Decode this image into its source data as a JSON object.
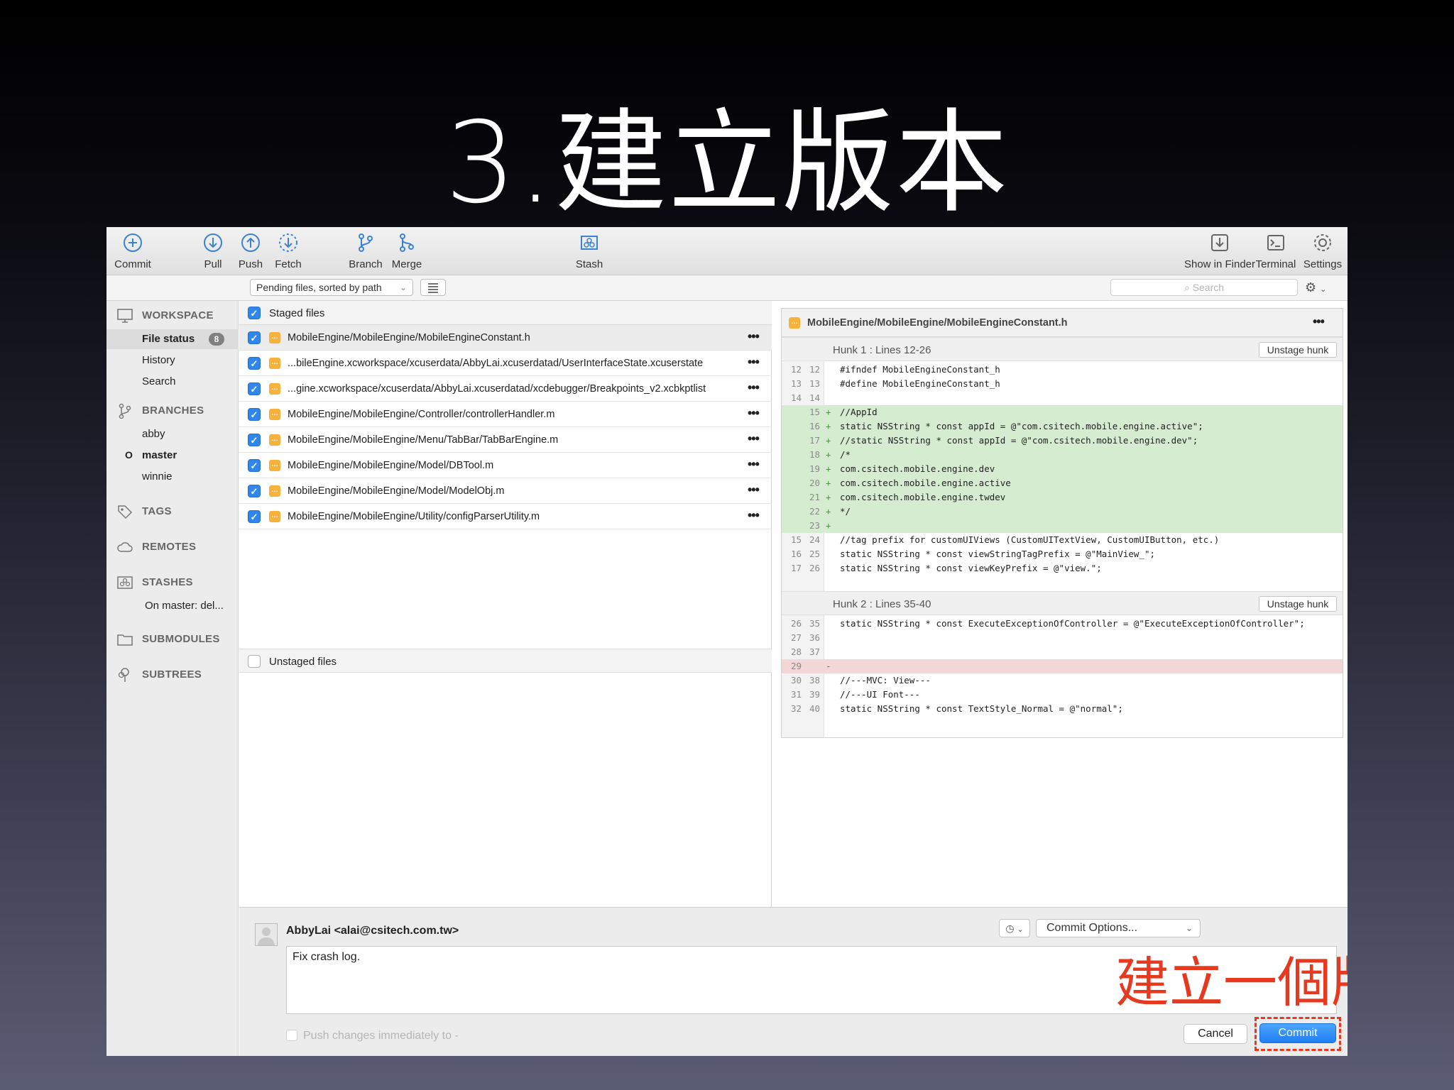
{
  "slide": {
    "title": "3.建立版本"
  },
  "toolbar": {
    "commit": "Commit",
    "pull": "Pull",
    "push": "Push",
    "fetch": "Fetch",
    "branch": "Branch",
    "merge": "Merge",
    "stash": "Stash",
    "show_in_finder": "Show in Finder",
    "terminal": "Terminal",
    "settings": "Settings"
  },
  "filter": {
    "sort_label": "Pending files, sorted by path",
    "search_placeholder": "Search"
  },
  "sidebar": {
    "workspace": "WORKSPACE",
    "file_status": "File status",
    "file_status_count": "8",
    "history": "History",
    "search": "Search",
    "branches": "BRANCHES",
    "branch_items": [
      "abby",
      "master",
      "winnie"
    ],
    "current_branch_marker": "O",
    "tags": "TAGS",
    "remotes": "REMOTES",
    "stashes": "STASHES",
    "stash_item": "On master: del...",
    "submodules": "SUBMODULES",
    "subtrees": "SUBTREES"
  },
  "files": {
    "staged_header": "Staged files",
    "unstaged_header": "Unstaged files",
    "more": "•••",
    "staged": [
      "MobileEngine/MobileEngine/MobileEngineConstant.h",
      "...bileEngine.xcworkspace/xcuserdata/AbbyLai.xcuserdatad/UserInterfaceState.xcuserstate",
      "...gine.xcworkspace/xcuserdata/AbbyLai.xcuserdatad/xcdebugger/Breakpoints_v2.xcbkptlist",
      "MobileEngine/MobileEngine/Controller/controllerHandler.m",
      "MobileEngine/MobileEngine/Menu/TabBar/TabBarEngine.m",
      "MobileEngine/MobileEngine/Model/DBTool.m",
      "MobileEngine/MobileEngine/Model/ModelObj.m",
      "MobileEngine/MobileEngine/Utility/configParserUtility.m"
    ]
  },
  "diff": {
    "file": "MobileEngine/MobileEngine/MobileEngineConstant.h",
    "more": "•••",
    "unstage": "Unstage hunk",
    "hunk1_label": "Hunk 1 : Lines 12-26",
    "hunk2_label": "Hunk 2 : Lines 35-40",
    "hunk1": [
      {
        "o": "12",
        "n": "12",
        "t": "",
        "c": "#ifndef MobileEngineConstant_h"
      },
      {
        "o": "13",
        "n": "13",
        "t": "",
        "c": "#define MobileEngineConstant_h"
      },
      {
        "o": "14",
        "n": "14",
        "t": "",
        "c": ""
      },
      {
        "o": "",
        "n": "15",
        "t": "add",
        "c": "//AppId"
      },
      {
        "o": "",
        "n": "16",
        "t": "add",
        "c": "static NSString * const appId = @\"com.csitech.mobile.engine.active\";"
      },
      {
        "o": "",
        "n": "17",
        "t": "add",
        "c": "//static NSString * const appId = @\"com.csitech.mobile.engine.dev\";"
      },
      {
        "o": "",
        "n": "18",
        "t": "add",
        "c": "/*"
      },
      {
        "o": "",
        "n": "19",
        "t": "add",
        "c": "com.csitech.mobile.engine.dev"
      },
      {
        "o": "",
        "n": "20",
        "t": "add",
        "c": "com.csitech.mobile.engine.active"
      },
      {
        "o": "",
        "n": "21",
        "t": "add",
        "c": "com.csitech.mobile.engine.twdev"
      },
      {
        "o": "",
        "n": "22",
        "t": "add",
        "c": "*/"
      },
      {
        "o": "",
        "n": "23",
        "t": "add",
        "c": ""
      },
      {
        "o": "15",
        "n": "24",
        "t": "",
        "c": "//tag prefix for customUIViews (CustomUITextView, CustomUIButton, etc.)"
      },
      {
        "o": "16",
        "n": "25",
        "t": "",
        "c": "static NSString * const viewStringTagPrefix = @\"MainView_\";"
      },
      {
        "o": "17",
        "n": "26",
        "t": "",
        "c": "static NSString * const viewKeyPrefix = @\"view.\";"
      }
    ],
    "hunk2": [
      {
        "o": "26",
        "n": "35",
        "t": "",
        "c": "static NSString * const ExecuteExceptionOfController = @\"ExecuteExceptionOfController\";"
      },
      {
        "o": "27",
        "n": "36",
        "t": "",
        "c": ""
      },
      {
        "o": "28",
        "n": "37",
        "t": "",
        "c": ""
      },
      {
        "o": "29",
        "n": "",
        "t": "del",
        "c": ""
      },
      {
        "o": "30",
        "n": "38",
        "t": "",
        "c": "//---MVC: View---"
      },
      {
        "o": "31",
        "n": "39",
        "t": "",
        "c": "//---UI Font---"
      },
      {
        "o": "32",
        "n": "40",
        "t": "",
        "c": "static NSString * const TextStyle_Normal = @\"normal\";"
      }
    ]
  },
  "commit": {
    "author": "AbbyLai <alai@csitech.com.tw>",
    "message": "Fix crash log.",
    "options": "Commit Options...",
    "push_label": "Push changes immediately to -",
    "cancel": "Cancel",
    "commit": "Commit",
    "annotation": "建立一個版本"
  },
  "colors": {
    "accent": "#2f86ee",
    "annotation_red": "#e6391f",
    "added_line": "#d5ecd0",
    "removed_line": "#f3d6d6",
    "modified_file": "#f7b23b"
  }
}
